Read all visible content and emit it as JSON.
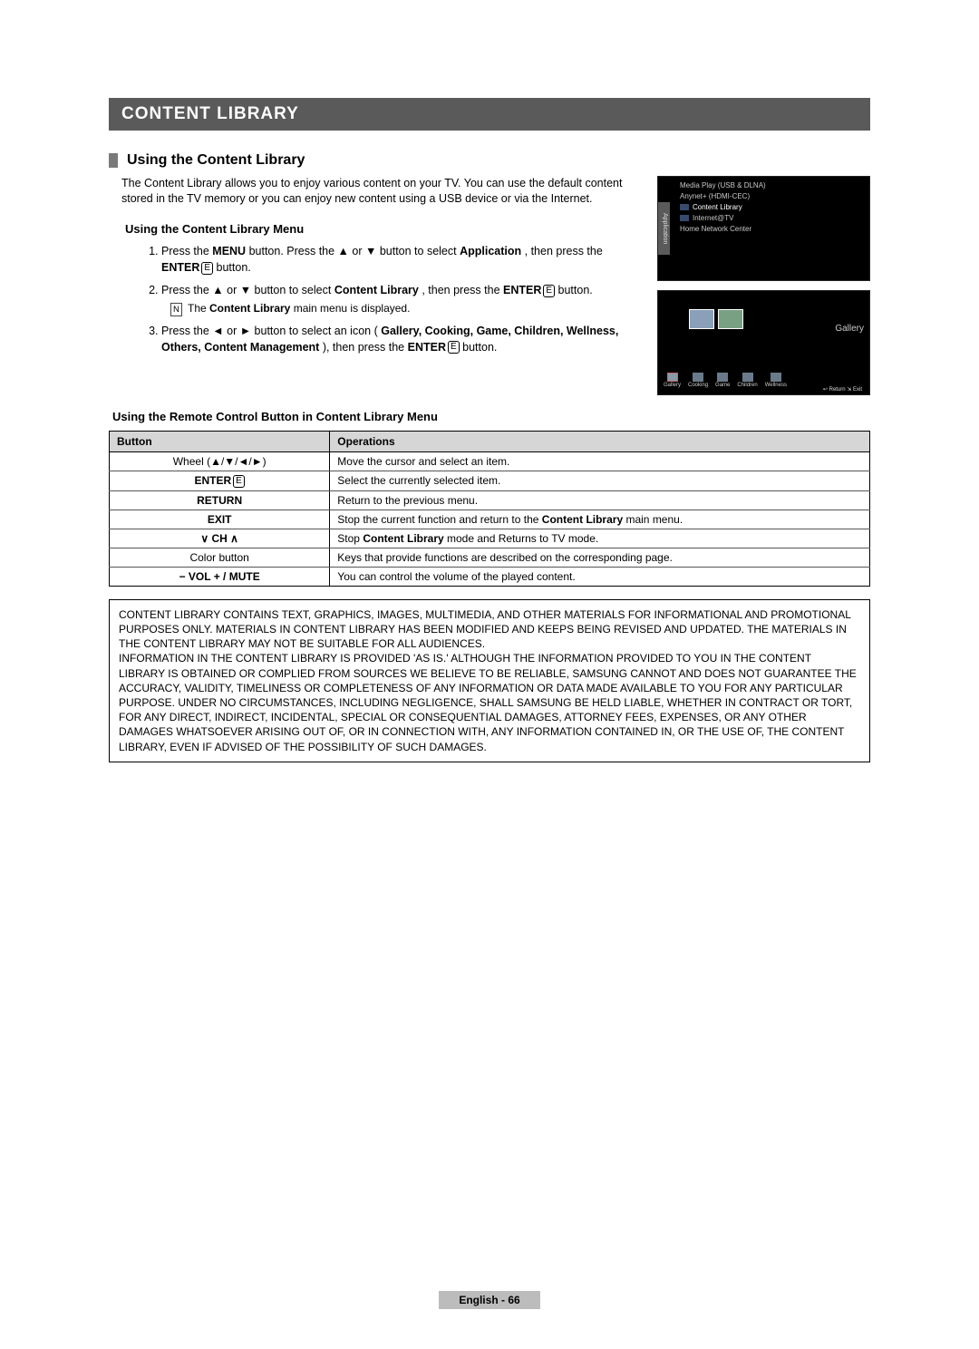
{
  "banner": "CONTENT LIBRARY",
  "section_title": "Using the Content Library",
  "intro": "The Content Library allows you to enjoy various content on your TV. You can use the default content stored in the TV memory or you can enjoy new content using a USB device or via the Internet.",
  "thumb1": {
    "tab": "Application",
    "items": [
      "Media Play (USB & DLNA)",
      "Anynet+ (HDMI-CEC)",
      "Content Library",
      "Internet@TV",
      "Home Network Center"
    ],
    "selected_index": 2
  },
  "thumb2": {
    "right_label": "Gallery",
    "categories": [
      "Gallery",
      "Cooking",
      "Game",
      "Children",
      "Wellness"
    ],
    "foot": "↩ Return   ⇲ Exit"
  },
  "subheading1": "Using the Content Library Menu",
  "steps": [
    {
      "pre": "Press the ",
      "b1": "MENU",
      "mid1": " button. Press the ▲ or ▼ button to select ",
      "b2": "Application",
      "mid2": ", then press the ",
      "b3": "ENTER",
      "enter_icon": "E",
      "post": " button."
    },
    {
      "pre": "Press the ▲ or ▼ button to select ",
      "b1": "Content Library",
      "mid1": ", then press the ",
      "b2": "ENTER",
      "enter_icon": "E",
      "post": " button.",
      "note_pre": "The ",
      "note_b": "Content Library",
      "note_post": " main menu is displayed."
    },
    {
      "pre": "Press the ◄ or ► button to select an icon (",
      "b1": "Gallery, Cooking, Game, Children, Wellness, Others, Content Management",
      "mid1": "), then press the ",
      "b2": "ENTER",
      "enter_icon": "E",
      "post": " button."
    }
  ],
  "subheading2": "Using the Remote Control Button in Content Library Menu",
  "table": {
    "headers": [
      "Button",
      "Operations"
    ],
    "rows": [
      {
        "btn_plain": "Wheel (▲/▼/◄/►)",
        "op": "Move the cursor and select an item."
      },
      {
        "btn_bold": "ENTER",
        "btn_icon": "E",
        "op": "Select the currently selected item."
      },
      {
        "btn_bold": "RETURN",
        "op": "Return to the previous menu."
      },
      {
        "btn_bold": "EXIT",
        "op_pre": "Stop the current function and return to the ",
        "op_b": "Content Library",
        "op_post": " main menu."
      },
      {
        "btn_bold": "∨ CH ∧",
        "op_pre": "Stop ",
        "op_b": "Content Library",
        "op_post": " mode and Returns to TV mode."
      },
      {
        "btn_plain": "Color button",
        "op": "Keys that provide functions are described on the corresponding page."
      },
      {
        "btn_bold": "− VOL +  / MUTE",
        "op": "You can control the volume of the played content."
      }
    ]
  },
  "disclaimer": [
    "CONTENT LIBRARY CONTAINS TEXT, GRAPHICS, IMAGES, MULTIMEDIA, AND OTHER MATERIALS FOR INFORMATIONAL AND PROMOTIONAL PURPOSES ONLY. MATERIALS IN CONTENT LIBRARY HAS BEEN MODIFIED AND KEEPS BEING REVISED AND UPDATED. THE MATERIALS IN THE CONTENT LIBRARY MAY NOT BE SUITABLE FOR ALL AUDIENCES.",
    "INFORMATION IN THE CONTENT LIBRARY IS PROVIDED 'AS IS.' ALTHOUGH THE INFORMATION PROVIDED TO YOU IN THE CONTENT LIBRARY IS OBTAINED OR COMPLIED FROM SOURCES WE BELIEVE TO BE RELIABLE, SAMSUNG CANNOT AND DOES NOT GUARANTEE THE ACCURACY, VALIDITY, TIMELINESS OR COMPLETENESS OF ANY INFORMATION OR DATA MADE AVAILABLE TO YOU FOR ANY PARTICULAR PURPOSE. UNDER NO CIRCUMSTANCES, INCLUDING NEGLIGENCE, SHALL SAMSUNG BE HELD LIABLE, WHETHER IN CONTRACT OR TORT, FOR ANY DIRECT, INDIRECT, INCIDENTAL, SPECIAL OR CONSEQUENTIAL DAMAGES, ATTORNEY FEES, EXPENSES, OR ANY OTHER DAMAGES WHATSOEVER ARISING OUT OF, OR IN CONNECTION WITH, ANY INFORMATION CONTAINED IN, OR THE USE OF, THE CONTENT LIBRARY, EVEN IF ADVISED OF THE POSSIBILITY OF SUCH DAMAGES."
  ],
  "footer": "English - 66",
  "icon_labels": {
    "note": "N",
    "enter": "E"
  }
}
